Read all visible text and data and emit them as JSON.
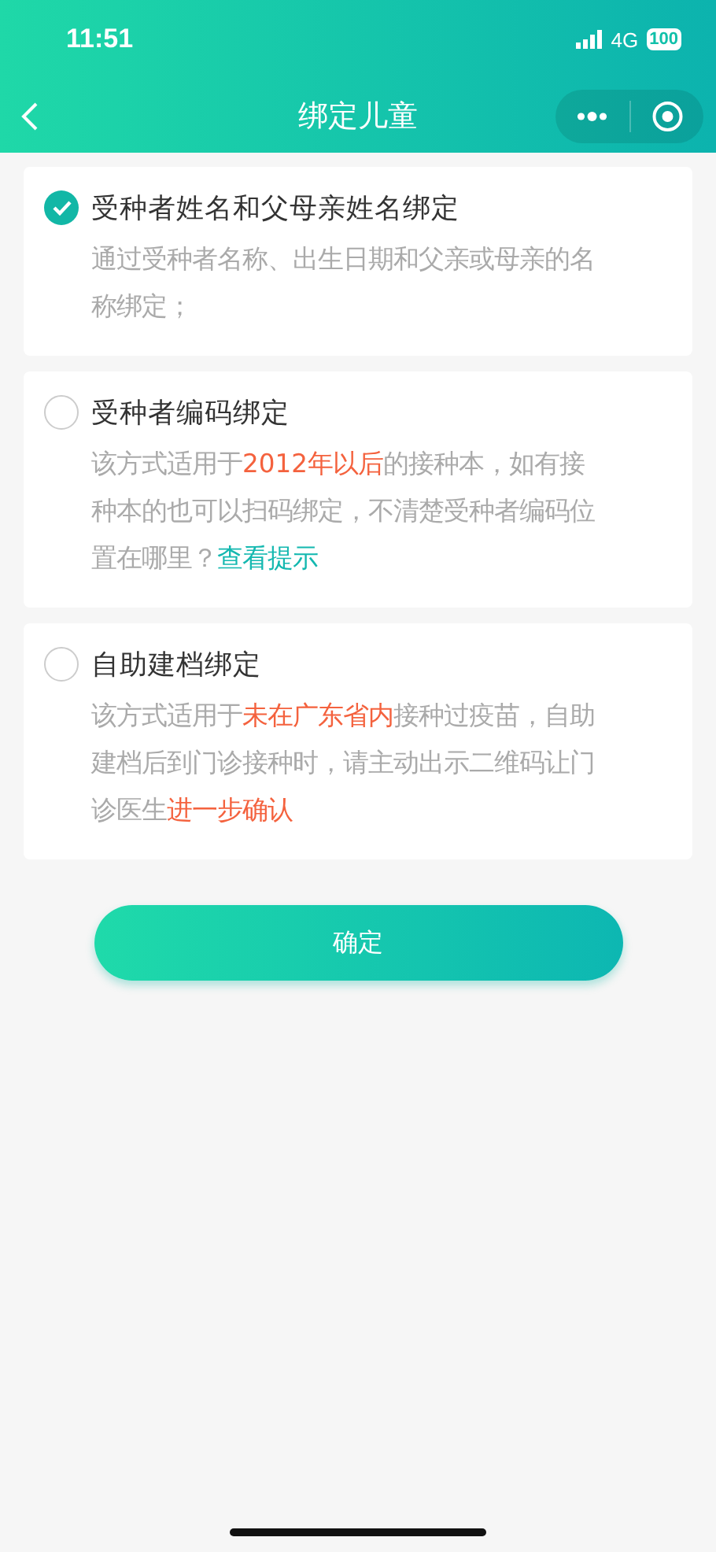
{
  "status_bar": {
    "time": "11:51",
    "network": "4G",
    "battery": "100"
  },
  "nav": {
    "title": "绑定儿童"
  },
  "options": [
    {
      "title": "受种者姓名和父母亲姓名绑定",
      "selected": true,
      "description": [
        {
          "kind": "plain",
          "text": "通过受种者名称、出生日期和父亲或母亲的名称绑定；"
        }
      ]
    },
    {
      "title": "受种者编码绑定",
      "selected": false,
      "description": [
        {
          "kind": "plain",
          "text": "该方式适用于"
        },
        {
          "kind": "highlight",
          "text": "2012年以后"
        },
        {
          "kind": "plain",
          "text": "的接种本，如有接种本的也可以扫码绑定，不清楚受种者编码位置在哪里？"
        },
        {
          "kind": "link",
          "text": "查看提示"
        }
      ]
    },
    {
      "title": "自助建档绑定",
      "selected": false,
      "description": [
        {
          "kind": "plain",
          "text": "该方式适用于"
        },
        {
          "kind": "highlight",
          "text": "未在广东省内"
        },
        {
          "kind": "plain",
          "text": "接种过疫苗，自助建档后到门诊接种时，请主动出示二维码让门诊医生"
        },
        {
          "kind": "highlight",
          "text": "进一步确认"
        }
      ]
    }
  ],
  "confirm_button": "确定"
}
